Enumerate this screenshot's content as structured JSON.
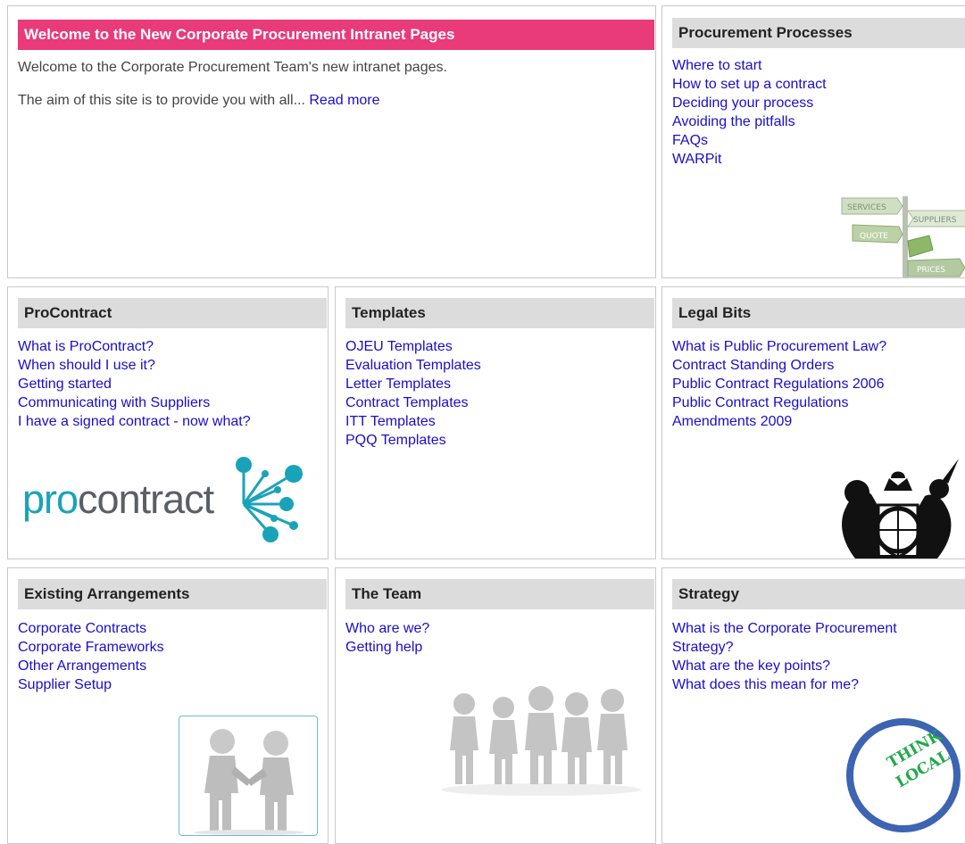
{
  "welcome": {
    "title": "Welcome to the New Corporate Procurement Intranet Pages",
    "line1": "Welcome to the Corporate Procurement Team's new intranet pages.",
    "line2": "The aim of this site is to provide you with all...",
    "read_more": "Read more"
  },
  "processes": {
    "title": "Procurement Processes",
    "links": [
      "Where to start",
      "How to set up a contract",
      "Deciding your process",
      "Avoiding the pitfalls",
      "FAQs",
      "WARPit"
    ],
    "signpost": {
      "services": "SERVICES",
      "suppliers": "SUPPLIERS",
      "quote": "QUOTE",
      "prices": "PRICES"
    }
  },
  "procontract": {
    "title": "ProContract",
    "links": [
      "What is ProContract?",
      "When should I use it?",
      "Getting started",
      "Communicating with Suppliers",
      "I have a signed contract - now what?"
    ],
    "logo_pro": "pro",
    "logo_contract": "contract"
  },
  "templates": {
    "title": "Templates",
    "links": [
      "OJEU Templates",
      "Evaluation Templates",
      "Letter Templates",
      "Contract Templates",
      "ITT Templates",
      "PQQ Templates"
    ]
  },
  "legal": {
    "title": "Legal Bits",
    "links": [
      "What is Public Procurement Law?",
      "Contract Standing Orders",
      "Public Contract Regulations 2006",
      "Public Contract Regulations",
      "Amendments 2009"
    ]
  },
  "arrangements": {
    "title": "Existing Arrangements",
    "links": [
      "Corporate Contracts",
      "Corporate Frameworks",
      "Other Arrangements",
      "Supplier Setup"
    ]
  },
  "team": {
    "title": "The Team",
    "links": [
      "Who are we?",
      "Getting help"
    ]
  },
  "strategy": {
    "title": "Strategy",
    "links": [
      "What is the Corporate Procurement",
      "Strategy?",
      "What are the key points?",
      "What does this mean for me?"
    ],
    "badge_line1": "THINK",
    "badge_line2": "LOCAL"
  },
  "colors": {
    "link": "#1a0dcc",
    "pink": "#e93a7a",
    "header_grey": "#dcdcdc",
    "procontract_teal": "#1aa3b8"
  }
}
